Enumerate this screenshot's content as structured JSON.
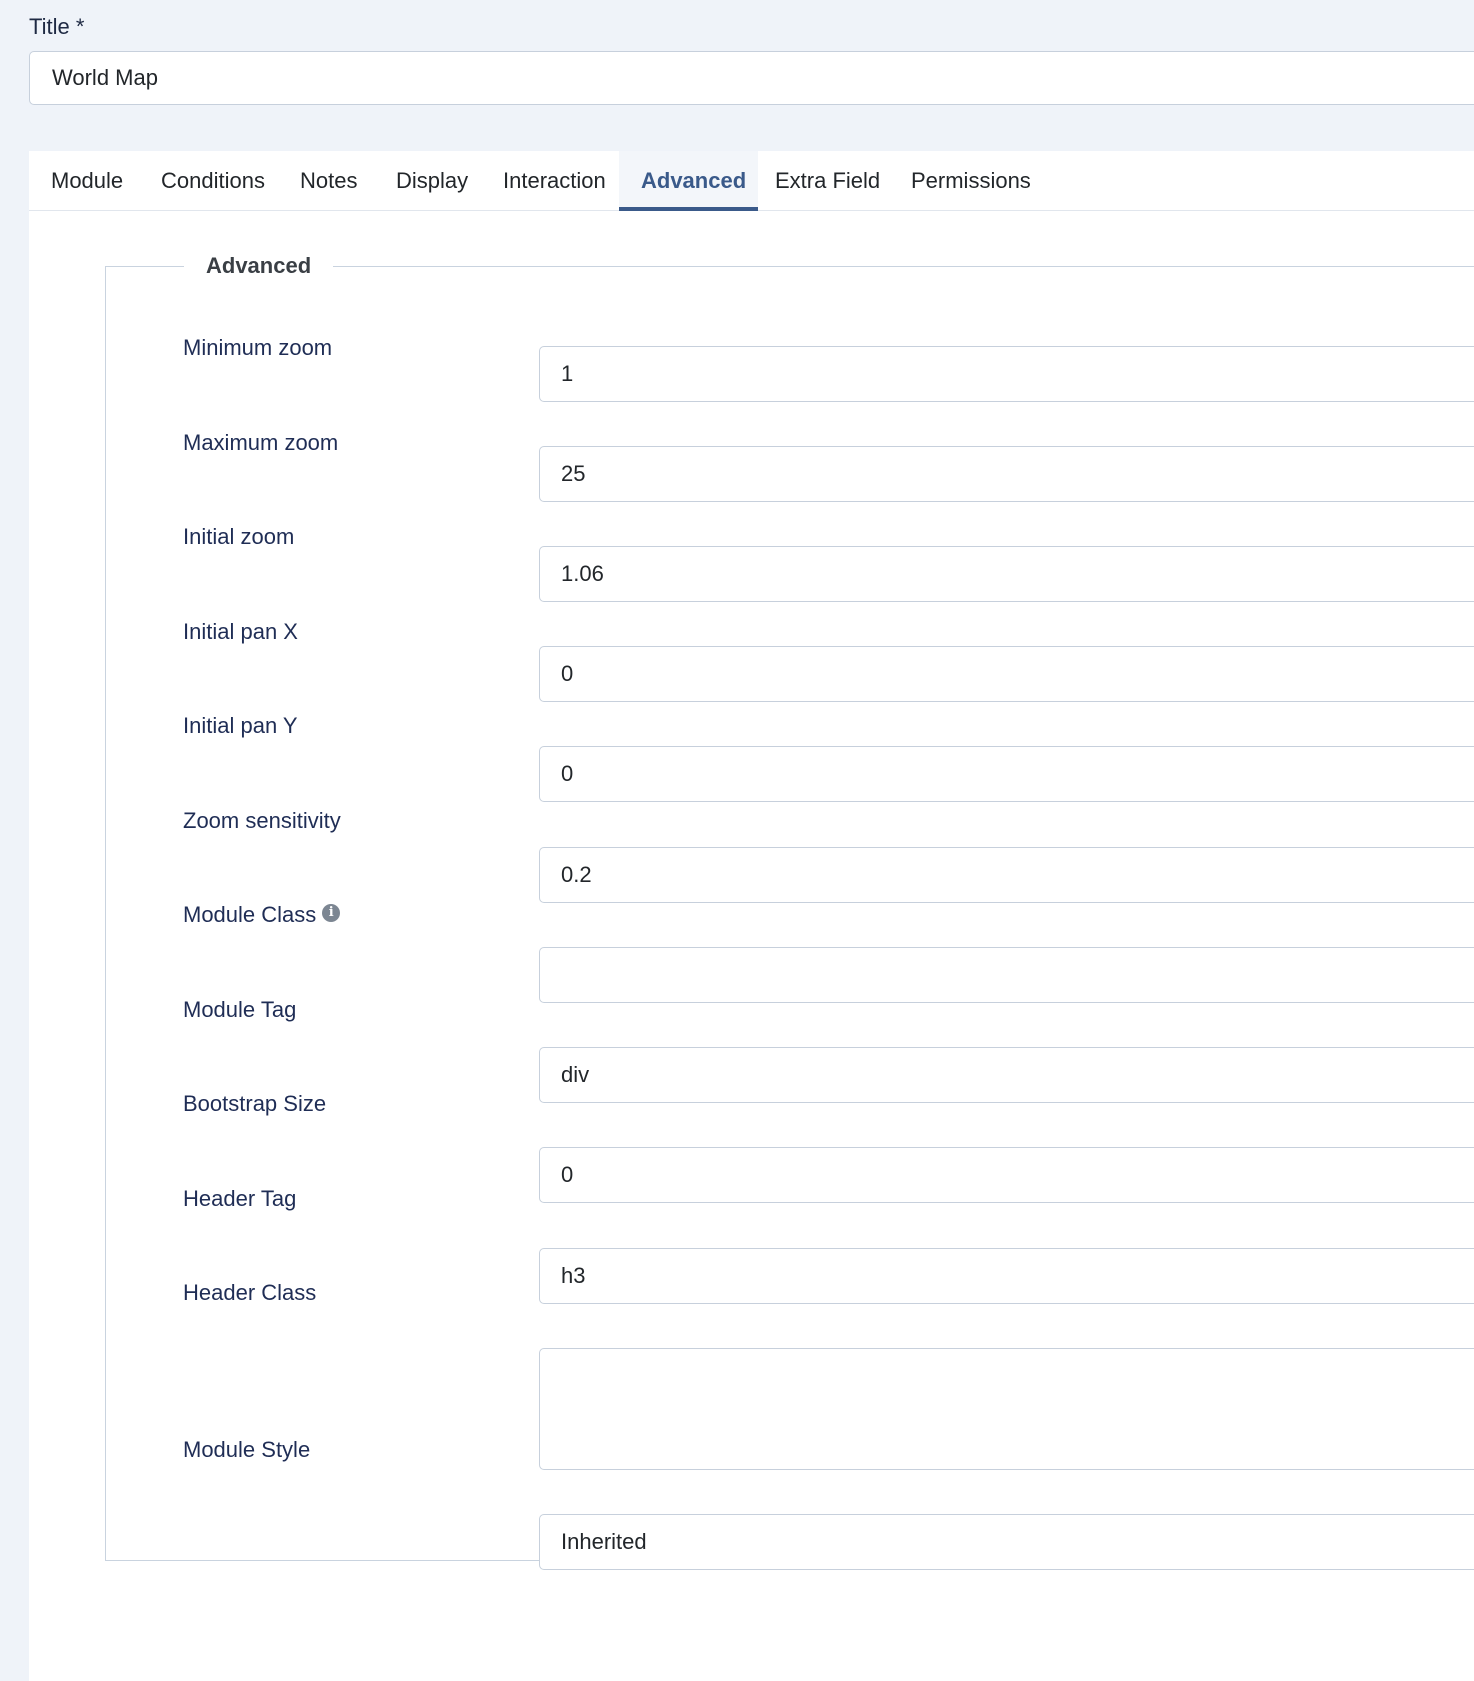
{
  "title_field": {
    "label": "Title *",
    "value": "World Map"
  },
  "tabs": [
    {
      "label": "Module"
    },
    {
      "label": "Conditions"
    },
    {
      "label": "Notes"
    },
    {
      "label": "Display"
    },
    {
      "label": "Interaction"
    },
    {
      "label": "Advanced",
      "active": true
    },
    {
      "label": "Extra Field"
    },
    {
      "label": "Permissions"
    }
  ],
  "fieldset": {
    "legend": "Advanced",
    "fields": [
      {
        "label": "Minimum zoom",
        "value": "1"
      },
      {
        "label": "Maximum zoom",
        "value": "25"
      },
      {
        "label": "Initial zoom",
        "value": "1.06"
      },
      {
        "label": "Initial pan X",
        "value": "0"
      },
      {
        "label": "Initial pan Y",
        "value": "0"
      },
      {
        "label": "Zoom sensitivity",
        "value": "0.2"
      },
      {
        "label": "Module Class",
        "value": "",
        "icon": "info-icon"
      },
      {
        "label": "Module Tag",
        "value": "div"
      },
      {
        "label": "Bootstrap Size",
        "value": "0"
      },
      {
        "label": "Header Tag",
        "value": "h3"
      },
      {
        "label": "Header Class",
        "value": ""
      },
      {
        "label": "Module Style",
        "value": "Inherited"
      }
    ]
  },
  "colors": {
    "page_background": "#eff3f9",
    "active_tab": "#3a5a8a",
    "label_text": "#1f2d55"
  }
}
